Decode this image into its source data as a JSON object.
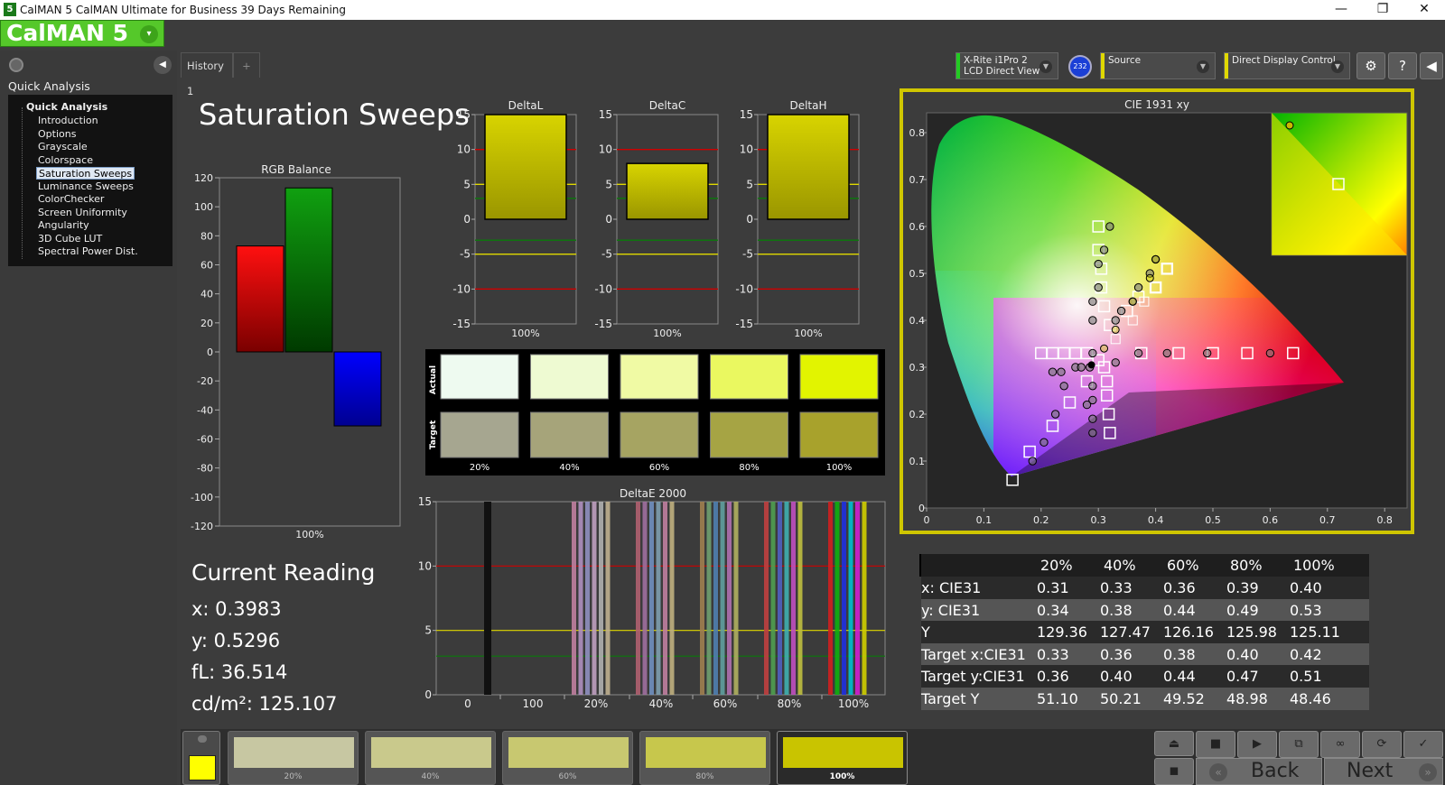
{
  "window": {
    "title": "CalMAN 5 CalMAN Ultimate for Business 39 Days Remaining",
    "app_icon": "5",
    "minimize": "—",
    "maximize": "❐",
    "close": "✕"
  },
  "logo": {
    "text": "CalMAN 5",
    "dropdown": "▾"
  },
  "sidebar": {
    "section": "Quick Analysis",
    "root": "Quick Analysis",
    "collapse": "◀",
    "items": [
      {
        "label": "Introduction"
      },
      {
        "label": "Options"
      },
      {
        "label": "Grayscale"
      },
      {
        "label": "Colorspace"
      },
      {
        "label": "Saturation Sweeps",
        "selected": true
      },
      {
        "label": "Luminance Sweeps"
      },
      {
        "label": "ColorChecker"
      },
      {
        "label": "Screen Uniformity"
      },
      {
        "label": "Angularity"
      },
      {
        "label": "3D Cube LUT"
      },
      {
        "label": "Spectral Power Dist."
      }
    ]
  },
  "tabs": [
    {
      "label": "History 1"
    },
    {
      "label": "+"
    }
  ],
  "devices": {
    "meter_line1": "X-Rite i1Pro 2",
    "meter_line2": "LCD Direct View",
    "meter_badge": "232",
    "source": "Source",
    "display": "Direct Display Control",
    "meter_color": "#22cc22",
    "source_color": "#e0d800",
    "display_color": "#e0d800"
  },
  "toolbar_icons": [
    "gear-icon",
    "help-icon",
    "collapse-icon"
  ],
  "page": {
    "title": "Saturation Sweeps"
  },
  "rgb_balance": {
    "title": "RGB Balance",
    "yticks": [
      "120",
      "100",
      "80",
      "60",
      "40",
      "20",
      "0",
      "-20",
      "-40",
      "-60",
      "-80",
      "-100",
      "-120"
    ],
    "xlabel": "100%"
  },
  "delta_charts": {
    "ticks": [
      "15",
      "10",
      "5",
      "0",
      "-5",
      "-10",
      "-15"
    ],
    "charts": [
      {
        "title": "DeltaL",
        "xlabel": "100%"
      },
      {
        "title": "DeltaC",
        "xlabel": "100%"
      },
      {
        "title": "DeltaH",
        "xlabel": "100%"
      }
    ]
  },
  "swatch_grid": {
    "actual_label": "Actual",
    "target_label": "Target",
    "columns": [
      "20%",
      "40%",
      "60%",
      "80%",
      "100%"
    ]
  },
  "deltae": {
    "title": "DeltaE 2000",
    "yticks": [
      "15",
      "10",
      "5",
      "0"
    ],
    "xticks": [
      "0",
      "100",
      "20%",
      "40%",
      "60%",
      "80%",
      "100%"
    ]
  },
  "cie": {
    "title": "CIE 1931 xy",
    "xticks": [
      "0",
      "0.1",
      "0.2",
      "0.3",
      "0.4",
      "0.5",
      "0.6",
      "0.7",
      "0.8"
    ],
    "yticks": [
      "0.8",
      "0.7",
      "0.6",
      "0.5",
      "0.4",
      "0.3",
      "0.2",
      "0.1",
      "0"
    ]
  },
  "current_reading": {
    "heading": "Current Reading",
    "x": "x: 0.3983",
    "y": "y: 0.5296",
    "fl": "fL: 36.514",
    "cdm": "cd/m²: 125.107"
  },
  "table": {
    "headers": [
      "20%",
      "40%",
      "60%",
      "80%",
      "100%"
    ],
    "rows": [
      {
        "label": "x: CIE31",
        "values": [
          "0.31",
          "0.33",
          "0.36",
          "0.39",
          "0.40"
        ]
      },
      {
        "label": "y: CIE31",
        "values": [
          "0.34",
          "0.38",
          "0.44",
          "0.49",
          "0.53"
        ]
      },
      {
        "label": "Y",
        "values": [
          "129.36",
          "127.47",
          "126.16",
          "125.98",
          "125.11"
        ]
      },
      {
        "label": "Target x:CIE31",
        "values": [
          "0.33",
          "0.36",
          "0.38",
          "0.40",
          "0.42"
        ]
      },
      {
        "label": "Target y:CIE31",
        "values": [
          "0.36",
          "0.40",
          "0.44",
          "0.47",
          "0.51"
        ]
      },
      {
        "label": "Target Y",
        "values": [
          "51.10",
          "50.21",
          "49.52",
          "48.98",
          "48.46"
        ]
      }
    ]
  },
  "bottom": {
    "swatches": [
      {
        "label": "20%",
        "color": "#c7c7a2"
      },
      {
        "label": "40%",
        "color": "#c9c98c"
      },
      {
        "label": "60%",
        "color": "#c8c870"
      },
      {
        "label": "80%",
        "color": "#c7c74c"
      },
      {
        "label": "100%",
        "color": "#c9c400"
      }
    ],
    "back": "Back",
    "next": "Next"
  },
  "chart_data": [
    {
      "type": "bar",
      "title": "RGB Balance",
      "categories": [
        "100%"
      ],
      "series": [
        {
          "values": [
            73
          ]
        },
        {
          "values": [
            113
          ]
        },
        {
          "values": [
            -51
          ]
        }
      ],
      "ylim": [
        -120,
        120
      ],
      "colors": [
        "#ff0000",
        "#00a000",
        "#0000ff"
      ]
    },
    {
      "type": "bar",
      "title": "DeltaL",
      "categories": [
        "100%"
      ],
      "values": [
        15
      ],
      "ylim": [
        -15,
        15
      ]
    },
    {
      "type": "bar",
      "title": "DeltaC",
      "categories": [
        "100%"
      ],
      "values": [
        8
      ],
      "ylim": [
        -15,
        15
      ]
    },
    {
      "type": "bar",
      "title": "DeltaH",
      "categories": [
        "100%"
      ],
      "values": [
        15
      ],
      "ylim": [
        -15,
        15
      ]
    },
    {
      "type": "bar",
      "title": "DeltaE 2000",
      "ylim": [
        0,
        15
      ]
    },
    {
      "type": "scatter",
      "title": "CIE 1931 xy",
      "xlim": [
        0,
        0.8
      ],
      "ylim": [
        0,
        0.8
      ],
      "series": [
        {
          "name": "x: CIE31 / y: CIE31",
          "x": [
            0.31,
            0.33,
            0.36,
            0.39,
            0.4
          ],
          "y": [
            0.34,
            0.38,
            0.44,
            0.49,
            0.53
          ]
        },
        {
          "name": "Target x:CIE31 / Target y:CIE31",
          "x": [
            0.33,
            0.36,
            0.38,
            0.4,
            0.42
          ],
          "y": [
            0.36,
            0.4,
            0.44,
            0.47,
            0.51
          ]
        }
      ]
    }
  ]
}
